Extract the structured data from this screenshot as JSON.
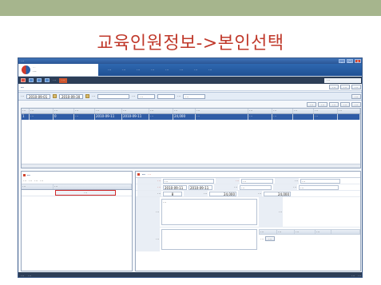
{
  "slide": {
    "title": "교육인원정보->본인선택"
  },
  "window": {
    "title": "⋯",
    "btn_min": "_",
    "btn_max": "□",
    "btn_close": "x"
  },
  "logo": {
    "name": "⋯",
    "sub": "⋯"
  },
  "nav": [
    "⋯",
    "⋯",
    "⋯",
    "⋯",
    "⋯",
    "⋯",
    "⋯",
    "⋯"
  ],
  "toolbar": {
    "path": "⋯",
    "search_placeholder": "⋯",
    "pill": "⋯"
  },
  "page": {
    "title": "⋯",
    "buttons": [
      "⋯",
      "⋯",
      "⋯"
    ]
  },
  "search": {
    "label_period": "⋯",
    "date_from": "2010-09-01",
    "date_to": "2010-09-30",
    "label_name": "⋯",
    "label_type": "⋯",
    "type_value": "⋯",
    "label_status": "⋯",
    "status_value": "⋯",
    "btn": "⋯"
  },
  "grid_buttons": [
    "⋯",
    "⋯",
    "⋯",
    "⋯",
    "⋯"
  ],
  "grid": {
    "columns": [
      "⋯",
      "⋯",
      "⋯",
      "⋯",
      "⋯",
      "⋯",
      "⋯",
      "⋯",
      "⋯",
      "⋯",
      "⋯",
      "⋯",
      "⋯",
      "⋯"
    ],
    "rows": [
      [
        "1",
        "⋯",
        "0",
        "⋯",
        "2010-09-11",
        "2010-09-11",
        "⋯",
        "24,000",
        "⋯",
        "⋯",
        "⋯",
        "",
        "⋯",
        ""
      ]
    ]
  },
  "left_panel": {
    "title": "⋯",
    "tools": [
      "⋯",
      "⋯",
      "⋯",
      "⋯"
    ],
    "columns": [
      "⋯",
      "⋯"
    ],
    "selected_value": "⋯"
  },
  "right_panel": {
    "title": "⋯",
    "notice": "⋯",
    "fields": {
      "course_label": "⋯",
      "course_value": "⋯",
      "edu_type_label": "⋯",
      "edu_type_value": "⋯",
      "org_label": "⋯",
      "org_value": "⋯",
      "period_label": "⋯",
      "period_from": "2010-09-11",
      "period_to": "2010-09-11",
      "place_label": "⋯",
      "place_value": "⋯",
      "hours_label": "⋯",
      "hours_value": "8",
      "fee_label": "⋯",
      "fee_value": "24,000",
      "time_label": "⋯",
      "time_value": "24,000",
      "extra_label": "⋯",
      "extra_value": "⋯"
    },
    "content_label": "⋯",
    "content_text": "⋯",
    "edu_result_label": "⋯",
    "etc_label": "⋯",
    "attach_columns": [
      "⋯",
      "⋯",
      "⋯",
      "⋯"
    ],
    "attach_label": "⋯",
    "attach_btn": "⋯"
  },
  "status": {
    "left": "⋯",
    "center": "⋯",
    "right1": "⋯",
    "right2": "⋯"
  }
}
